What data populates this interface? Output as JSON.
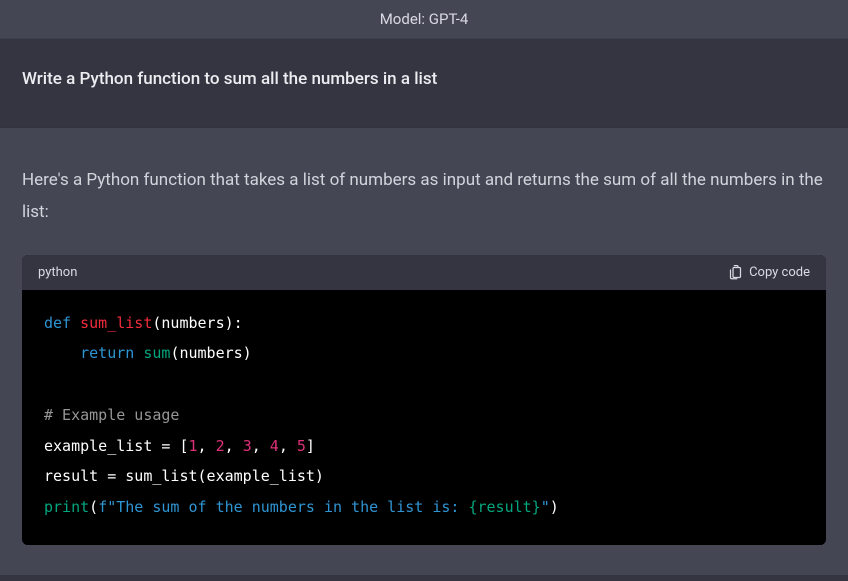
{
  "header": {
    "model_line": "Model: GPT-4"
  },
  "user": {
    "prompt": "Write a Python function to sum all the numbers in a list"
  },
  "assistant": {
    "intro": "Here's a Python function that takes a list of numbers as input and returns the sum of all the numbers in the list:"
  },
  "code": {
    "language": "python",
    "copy_label": "Copy code",
    "tokens": {
      "def": "def",
      "fn_name": "sum_list",
      "param_open": "(numbers):",
      "return_kw": "return",
      "sum_call": "sum",
      "sum_arg": "(numbers)",
      "comment": "# Example usage",
      "ex_list_lhs": "example_list = [",
      "n1": "1",
      "c1": ", ",
      "n2": "2",
      "c2": ", ",
      "n3": "3",
      "c3": ", ",
      "n4": "4",
      "c4": ", ",
      "n5": "5",
      "close_br": "]",
      "result_lhs": "result = sum_list(example_list)",
      "print_id": "print",
      "print_open": "(",
      "f_prefix": "f\"The sum of the numbers in the list is: ",
      "interp": "{result}",
      "str_close": "\"",
      "print_close": ")"
    }
  }
}
